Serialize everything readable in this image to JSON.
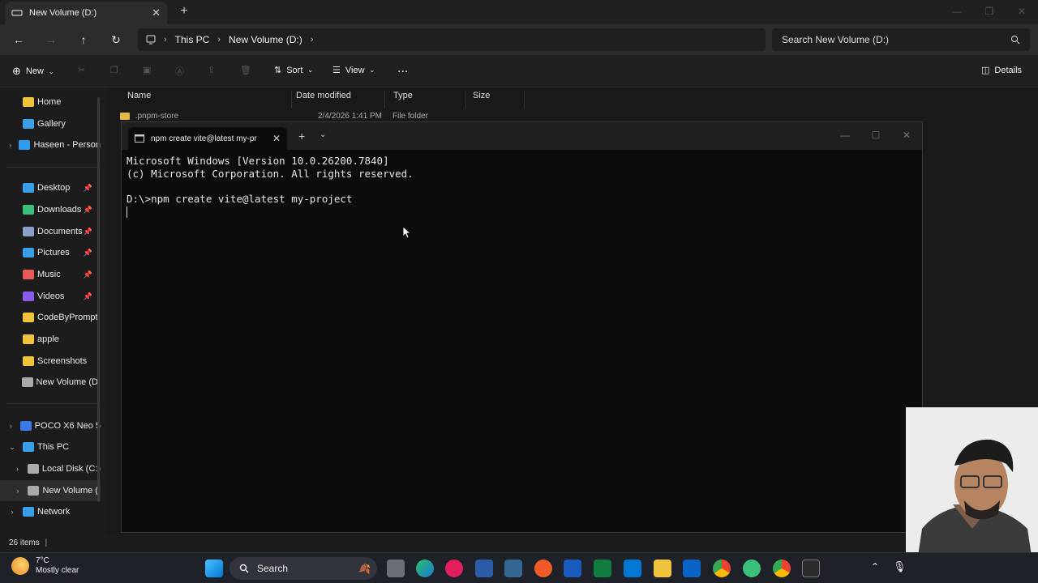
{
  "explorer": {
    "tab_title": "New Volume (D:)",
    "breadcrumb": [
      "This PC",
      "New Volume (D:)"
    ],
    "search_placeholder": "Search New Volume (D:)",
    "toolbar": {
      "new": "New",
      "sort": "Sort",
      "view": "View",
      "more": "...",
      "details": "Details"
    },
    "columns": [
      "Name",
      "Date modified",
      "Type",
      "Size"
    ],
    "first_row": {
      "name": ".pnpm-store",
      "date": "2/4/2026 1:41 PM",
      "type": "File folder"
    },
    "sidebar": {
      "top": [
        {
          "label": "Home",
          "color": "#f0c33c"
        },
        {
          "label": "Gallery",
          "color": "#3aa0e8"
        },
        {
          "label": "Haseen - Person",
          "color": "#2b9cf4"
        }
      ],
      "quick": [
        {
          "label": "Desktop",
          "color": "#3aa0e8"
        },
        {
          "label": "Downloads",
          "color": "#3ac07a"
        },
        {
          "label": "Documents",
          "color": "#8aa0c8"
        },
        {
          "label": "Pictures",
          "color": "#3aa0e8"
        },
        {
          "label": "Music",
          "color": "#e85a5a"
        },
        {
          "label": "Videos",
          "color": "#8a5ae8"
        },
        {
          "label": "CodeByPrompt",
          "color": "#f0c33c"
        },
        {
          "label": "apple",
          "color": "#f0c33c"
        },
        {
          "label": "Screenshots",
          "color": "#f0c33c"
        },
        {
          "label": "New Volume (D:",
          "color": "#aaaaaa"
        }
      ],
      "tree": [
        {
          "label": "POCO X6 Neo 5",
          "color": "#3a7ae8"
        },
        {
          "label": "This PC",
          "color": "#3aa0e8"
        },
        {
          "label": "Local Disk (C:)",
          "color": "#aaaaaa"
        },
        {
          "label": "New Volume (I",
          "color": "#aaaaaa"
        },
        {
          "label": "Network",
          "color": "#3aa0e8"
        }
      ]
    },
    "status": "26 items"
  },
  "terminal": {
    "tab_title": "npm create vite@latest my-pr",
    "lines": [
      "Microsoft Windows [Version 10.0.26200.7840]",
      "(c) Microsoft Corporation. All rights reserved.",
      "",
      "D:\\>npm create vite@latest my-project"
    ]
  },
  "taskbar": {
    "temp": "7°C",
    "weather": "Mostly clear",
    "search": "Search"
  }
}
